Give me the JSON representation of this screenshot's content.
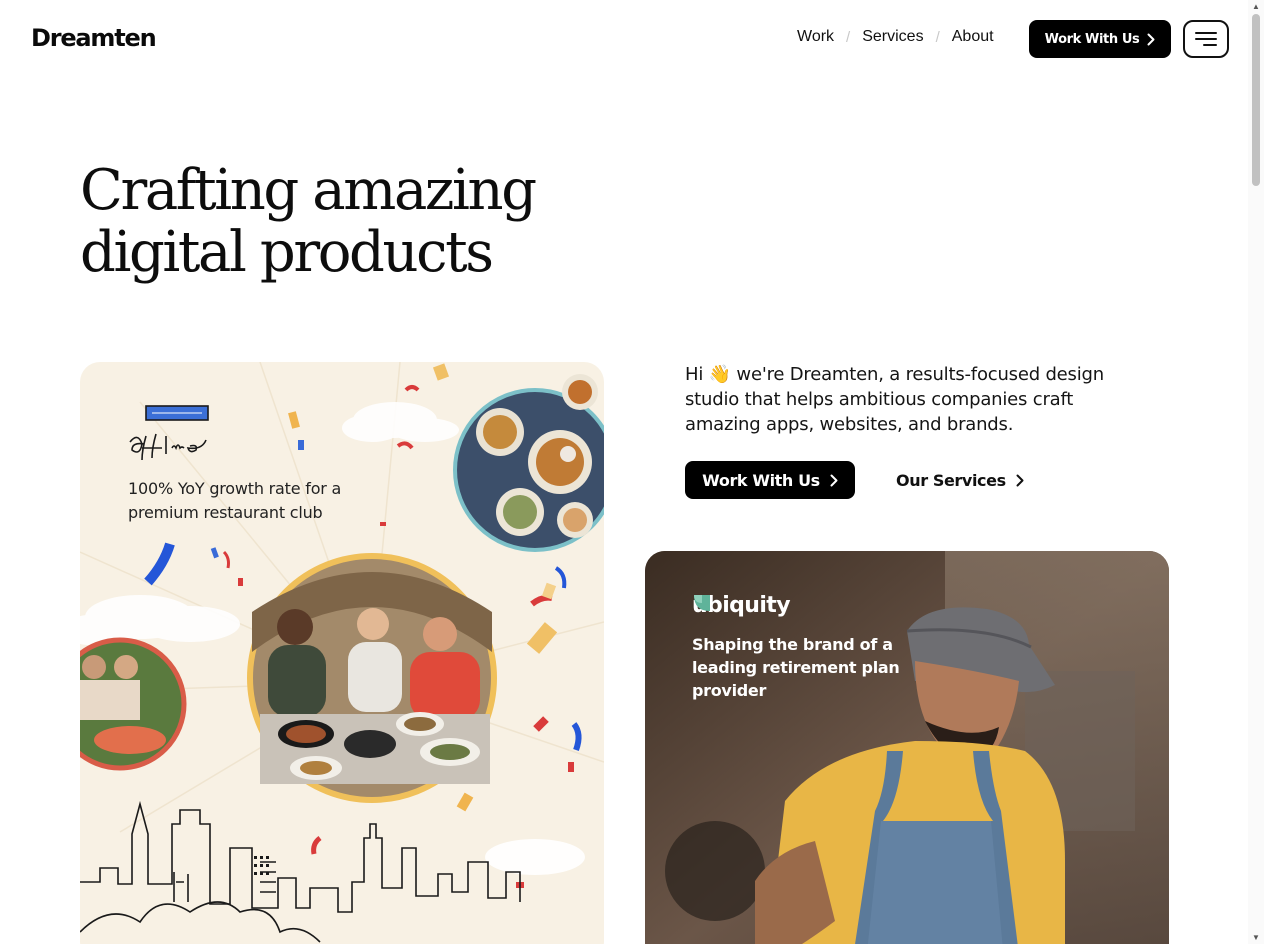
{
  "header": {
    "logo": "Dreamten",
    "nav": [
      {
        "label": "Work"
      },
      {
        "label": "Services"
      },
      {
        "label": "About"
      }
    ],
    "nav_separator": "/",
    "cta_label": "Work With Us",
    "menu_icon": "hamburger-menu-icon"
  },
  "hero": {
    "title_line1": "Crafting amazing",
    "title_line2": "digital products"
  },
  "intro": {
    "greeting": "Hi",
    "emoji": "👋",
    "text": "we're Dreamten, a results-focused design studio that helps ambitious companies craft amazing apps, websites, and brands.",
    "primary_cta": "Work With Us",
    "secondary_cta": "Our Services"
  },
  "cards": [
    {
      "logo_text": "offline",
      "description": "100% YoY growth rate for a premium restaurant club",
      "background": "#f8f1e4"
    },
    {
      "brand": "ubiquity",
      "description": "Shaping the brand of a leading retirement plan provider",
      "accent": "#5fb39a"
    }
  ],
  "colors": {
    "primary": "#000000",
    "text": "#111111",
    "background": "#ffffff"
  }
}
